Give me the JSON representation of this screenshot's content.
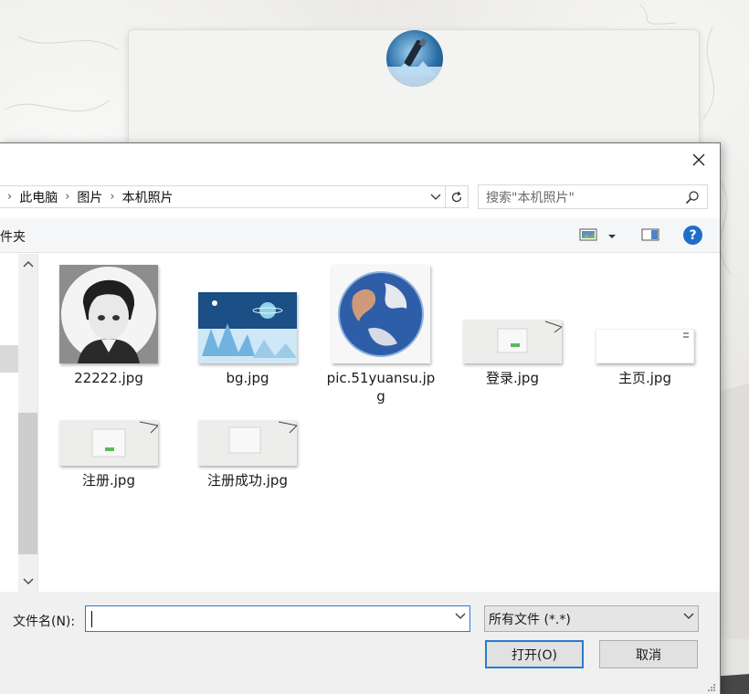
{
  "page": {
    "avatar_icon": "wand-avatar-icon"
  },
  "dialog": {
    "close_icon": "close-icon",
    "breadcrumb": [
      "此电脑",
      "图片",
      "本机照片"
    ],
    "search_placeholder": "搜索\"本机照片\"",
    "toolbar_left_label": "件夹",
    "icons": [
      "view-icon",
      "chevron-down-icon",
      "preview-pane-icon",
      "help-icon"
    ],
    "help_glyph": "?",
    "files": [
      {
        "name": "22222.jpg"
      },
      {
        "name": "bg.jpg"
      },
      {
        "name": "pic.51yuansu.jpg"
      },
      {
        "name": "登录.jpg"
      },
      {
        "name": "主页.jpg"
      },
      {
        "name": "注册.jpg"
      },
      {
        "name": "注册成功.jpg"
      }
    ],
    "filename_label": "文件名(N):",
    "filename_value": "",
    "filetype_value": "所有文件 (*.*)",
    "open_label": "打开(O)",
    "cancel_label": "取消"
  },
  "colors": {
    "accent": "#2a7bd0",
    "help": "#1e6ec8"
  }
}
